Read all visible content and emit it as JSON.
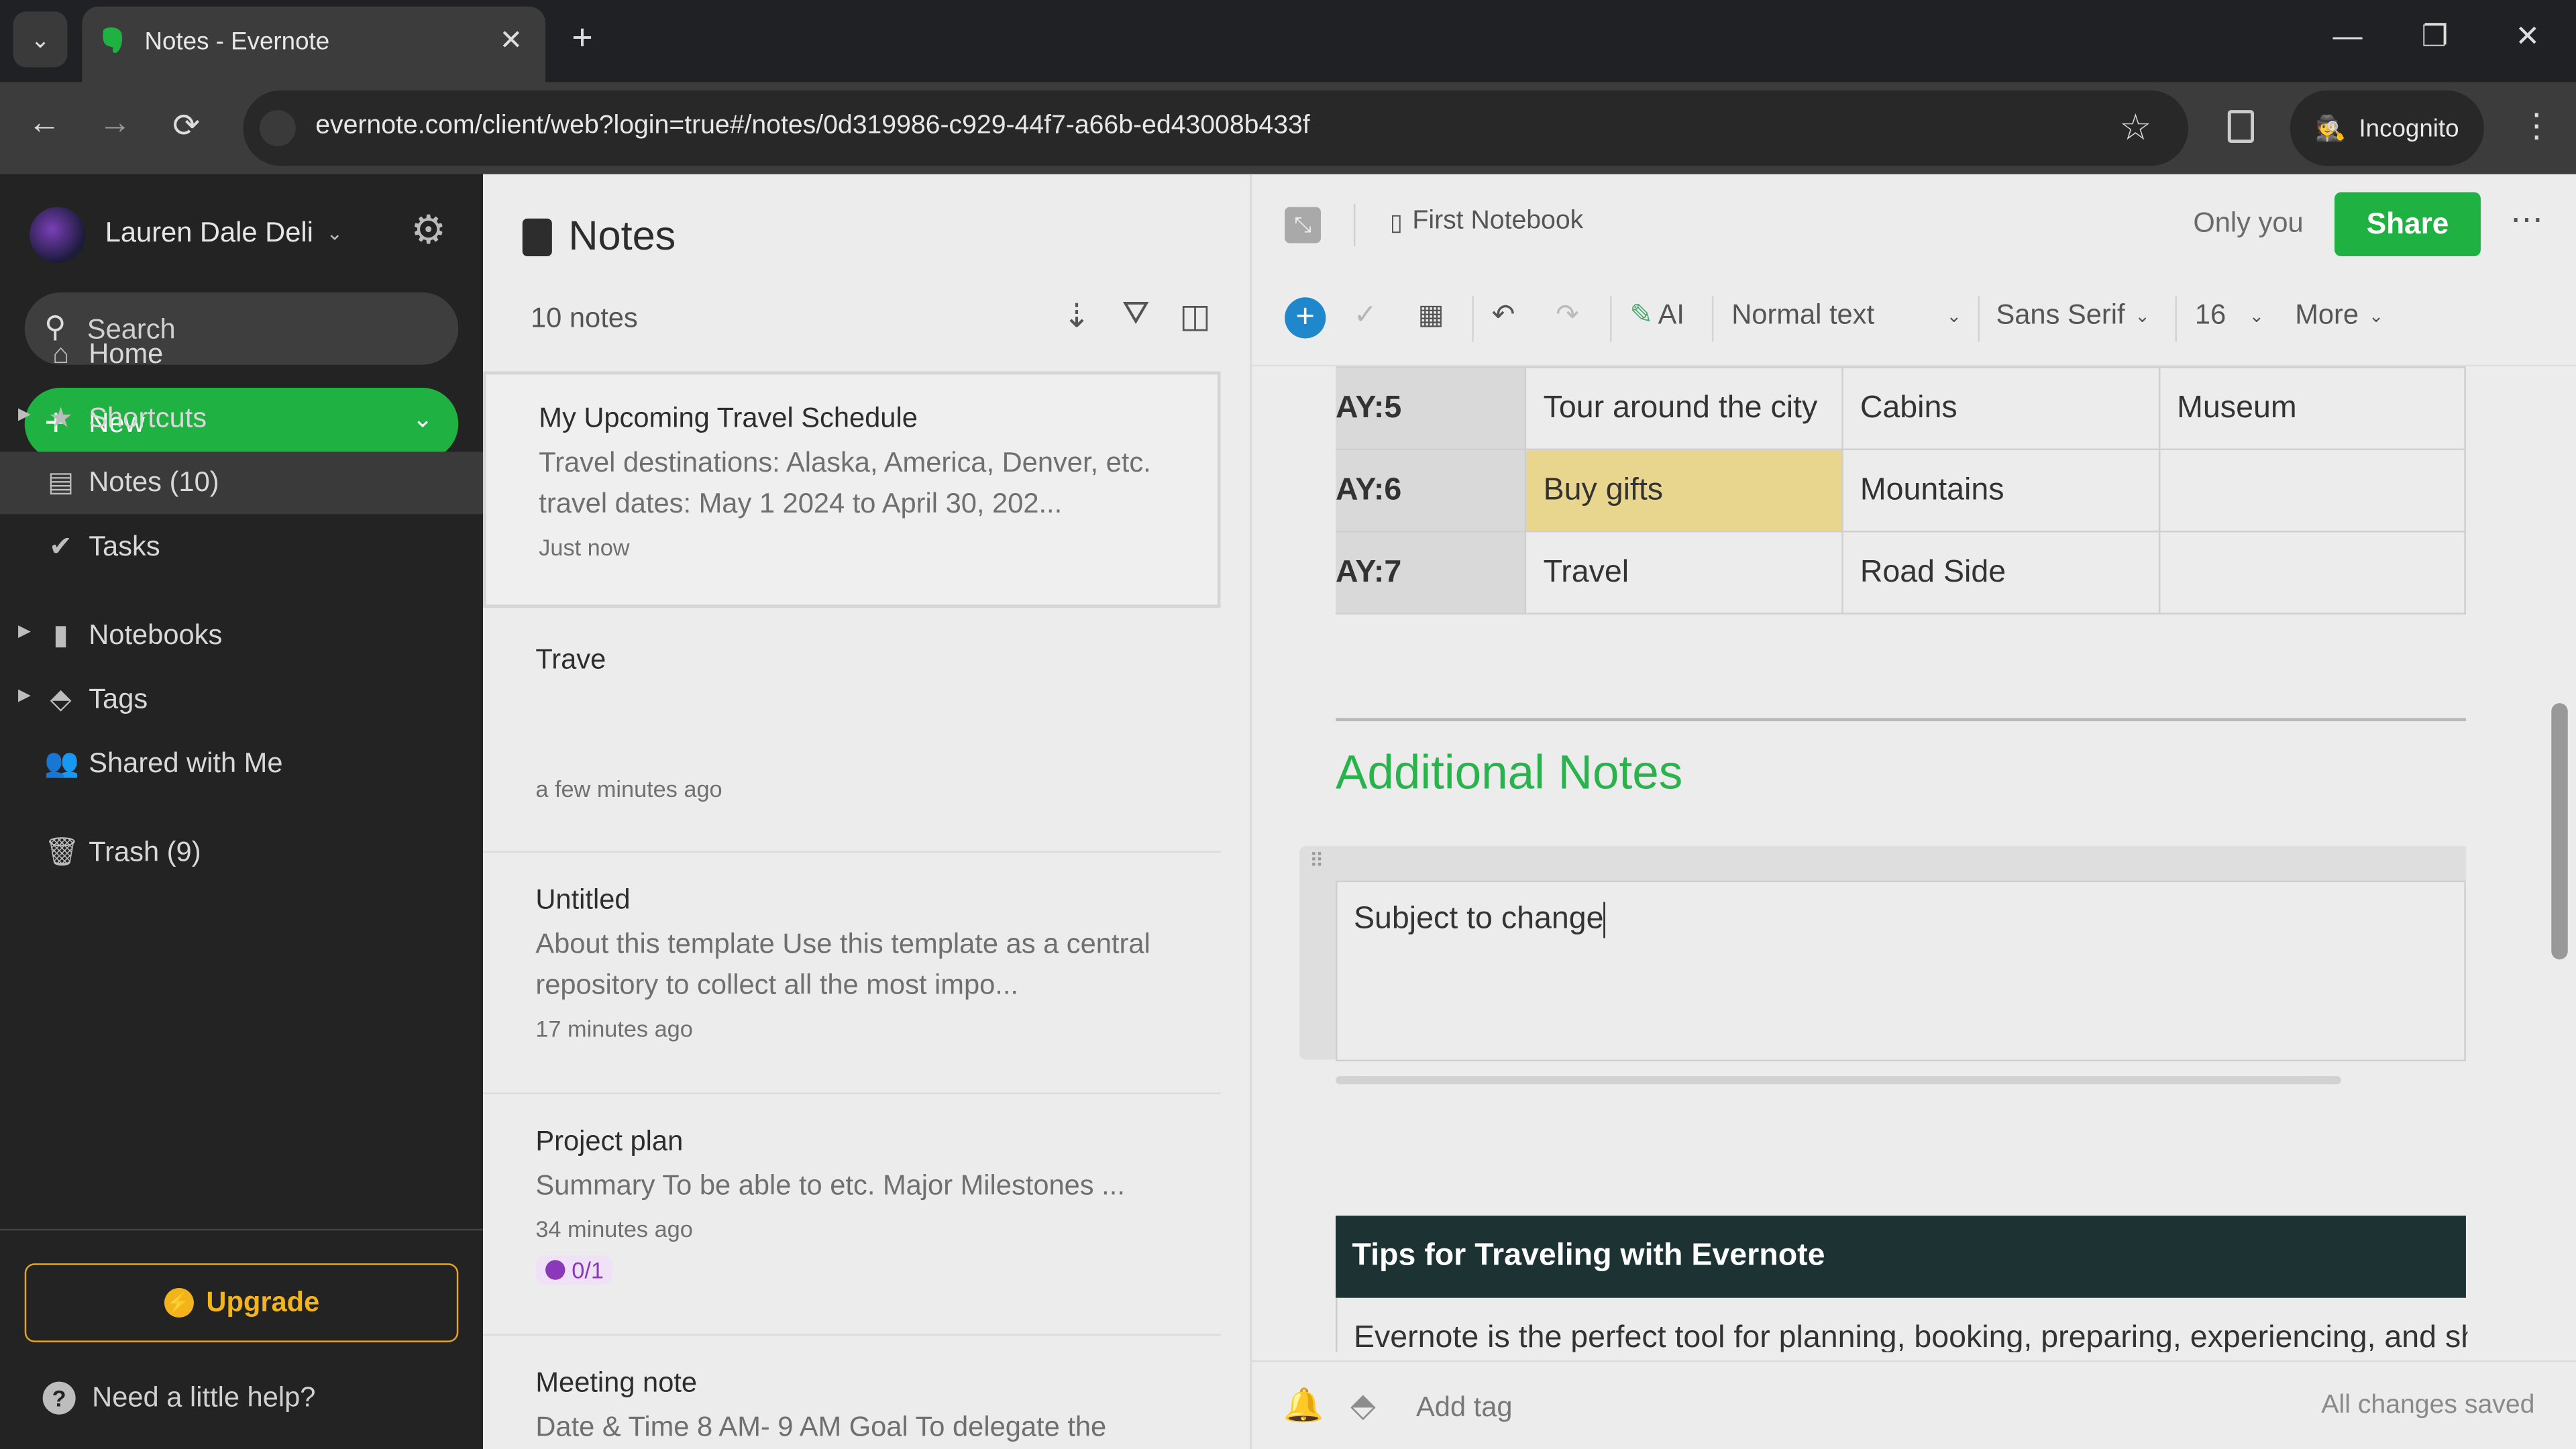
{
  "browser": {
    "tab_title": "Notes - Evernote",
    "url": "evernote.com/client/web?login=true#/notes/0d319986-c929-44f7-a66b-ed43008b433f",
    "incognito_label": "Incognito",
    "icons": {
      "back": "←",
      "forward": "→",
      "reload": "⟳",
      "star": "☆",
      "kebab": "⋮",
      "close": "✕",
      "new_tab": "+",
      "minimize": "—",
      "restore": "❐",
      "win_close": "✕",
      "tab_menu": "⌄"
    }
  },
  "sidebar": {
    "user_name": "Lauren Dale Deli",
    "search_placeholder": "Search",
    "new_label": "New",
    "items": [
      {
        "label": "Home",
        "icon": "⌂",
        "caret": false
      },
      {
        "label": "Shortcuts",
        "icon": "★",
        "caret": true
      },
      {
        "label": "Notes (10)",
        "icon": "▤",
        "caret": false,
        "active": true
      },
      {
        "label": "Tasks",
        "icon": "✔",
        "caret": false
      },
      {
        "label": "Notebooks",
        "icon": "▮",
        "caret": true
      },
      {
        "label": "Tags",
        "icon": "⬘",
        "caret": true
      },
      {
        "label": "Shared with Me",
        "icon": "👥",
        "caret": false
      },
      {
        "label": "Trash (9)",
        "icon": "🗑",
        "caret": false
      }
    ],
    "upgrade_label": "Upgrade",
    "help_label": "Need a little help?",
    "colors": {
      "accent_green": "#1fb141",
      "upgrade_gold": "#f2b31b"
    }
  },
  "notes_list": {
    "title": "Notes",
    "count": "10 notes",
    "notes": [
      {
        "title": "My Upcoming Travel Schedule",
        "snippet": "Travel destinations: Alaska, America, Denver, etc. travel dates: May 1 2024 to April 30, 202...",
        "time": "Just now",
        "selected": true
      },
      {
        "title": "Trave",
        "snippet": "",
        "time": "a few minutes ago"
      },
      {
        "title": "Untitled",
        "snippet": "About this template Use this template as a central repository to collect all the most impo...",
        "time": "17 minutes ago"
      },
      {
        "title": "Project plan",
        "snippet": "Summary To be able to etc. Major Milestones ...",
        "time": "34 minutes ago",
        "tasks": "0/1"
      },
      {
        "title": "Meeting note",
        "snippet": "Date & Time 8 AM- 9 AM Goal To delegate the",
        "time": ""
      }
    ]
  },
  "editor": {
    "notebook": "First Notebook",
    "visibility": "Only you",
    "share_label": "Share",
    "toolbar": {
      "ai_label": "AI",
      "text_style": "Normal text",
      "font": "Sans Serif",
      "size": "16",
      "more": "More"
    },
    "table_rows": [
      {
        "day": "AY:5",
        "cells": [
          "Tour around the city",
          "Cabins",
          "Museum"
        ]
      },
      {
        "day": "AY:6",
        "cells": [
          "Buy gifts",
          "Mountains",
          ""
        ],
        "highlight": 0
      },
      {
        "day": "AY:7",
        "cells": [
          "Travel",
          "Road Side",
          ""
        ]
      }
    ],
    "heading": "Additional Notes",
    "block_text": "Subject to change",
    "tips_heading": "Tips for Traveling with Evernote",
    "tips_body": "Evernote is the perfect tool for planning, booking, preparing, experiencing, and sharing",
    "add_tag": "Add tag",
    "status": "All changes saved",
    "colors": {
      "heading_green": "#2ab24c",
      "highlight_yellow": "#e8d68f",
      "tips_bg": "#1c3233",
      "plus_blue": "#1f87cc"
    }
  }
}
